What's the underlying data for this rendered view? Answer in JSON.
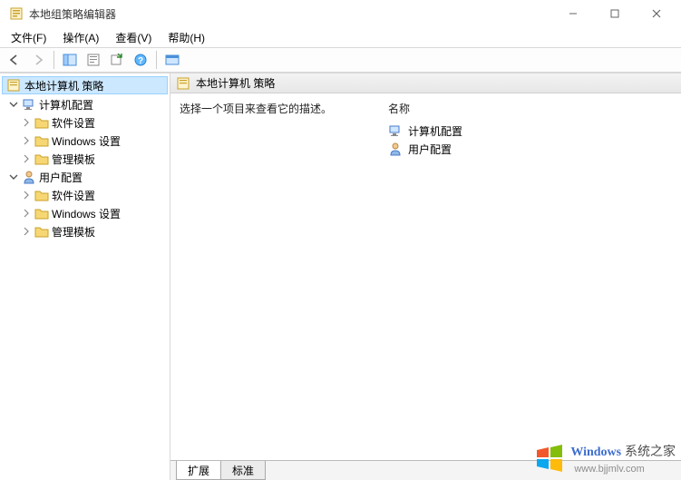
{
  "window": {
    "title": "本地组策略编辑器",
    "minimize": "—",
    "maximize": "□",
    "close": "✕"
  },
  "menubar": {
    "file": "文件(F)",
    "action": "操作(A)",
    "view": "查看(V)",
    "help": "帮助(H)"
  },
  "toolbar_icons": {
    "back": "nav-back-icon",
    "forward": "nav-forward-icon",
    "panes": "panes-icon",
    "sheet": "sheet-icon",
    "export": "export-icon",
    "help": "help-icon",
    "window": "window-icon"
  },
  "tree": {
    "root": "本地计算机 策略",
    "computer_config": "计算机配置",
    "software_settings": "软件设置",
    "windows_settings": "Windows 设置",
    "admin_templates": "管理模板",
    "user_config": "用户配置"
  },
  "details": {
    "header": "本地计算机 策略",
    "description": "选择一个项目来查看它的描述。",
    "name_column": "名称",
    "items": {
      "computer": "计算机配置",
      "user": "用户配置"
    }
  },
  "tabs": {
    "extended": "扩展",
    "standard": "标准"
  },
  "watermark": {
    "brand1": "Windows",
    "brand2": "系统之家",
    "url": "www.bjjmlv.com"
  }
}
